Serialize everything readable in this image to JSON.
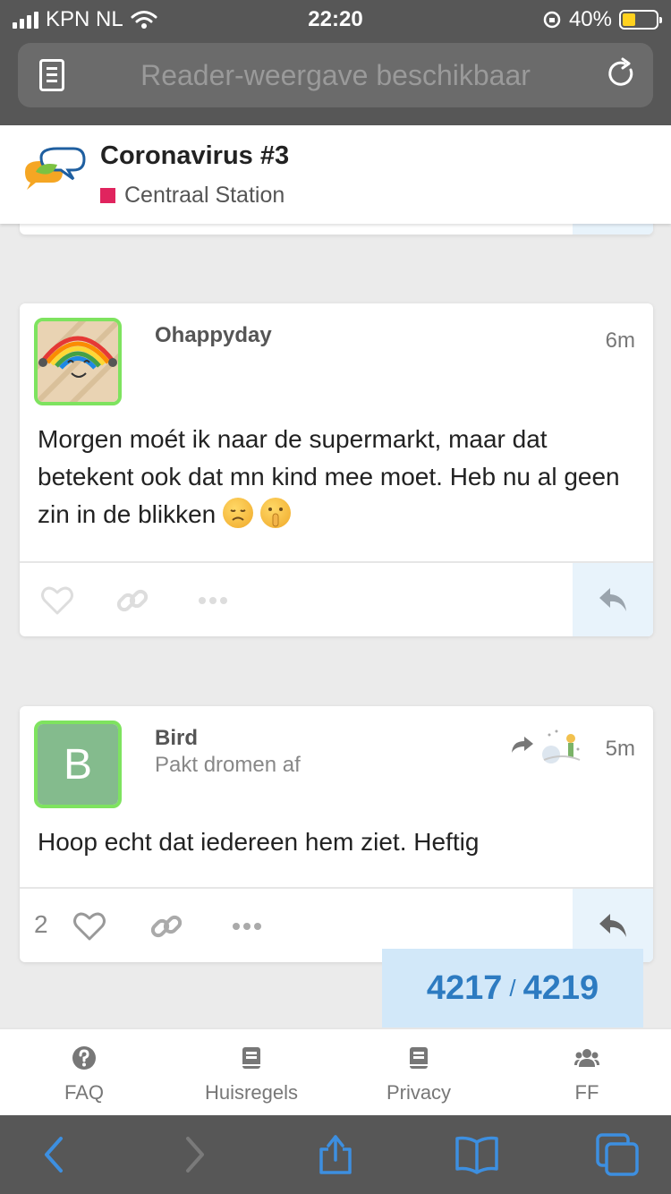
{
  "status_bar": {
    "carrier": "KPN NL",
    "time": "22:20",
    "battery": "40%",
    "battery_level": 0.4
  },
  "browser": {
    "url_placeholder": "Reader-weergave beschikbaar"
  },
  "topic": {
    "title": "Coronavirus #3",
    "category": "Centraal Station",
    "category_color": "#e0245e"
  },
  "posts": [
    {
      "username": "Ohappyday",
      "time": "6m",
      "body": "Morgen moét ik naar de supermarkt, maar dat betekent ook dat mn kind mee moet. Heb nu al geen zin in de blikken",
      "emojis": [
        "disappointed-face",
        "shushing-face"
      ],
      "avatar": "rainbow-face"
    },
    {
      "username": "Bird",
      "user_title": "Pakt dromen af",
      "avatar_letter": "B",
      "avatar_color": "#84bb8d",
      "time": "5m",
      "body": "Hoop echt dat iedereen hem ziet. Heftig",
      "like_count": "2"
    }
  ],
  "progress": {
    "current": "4217",
    "separator": "/",
    "total": "4219"
  },
  "footer_nav": [
    {
      "label": "FAQ",
      "icon": "question-circle-icon"
    },
    {
      "label": "Huisregels",
      "icon": "book-icon"
    },
    {
      "label": "Privacy",
      "icon": "book-icon"
    },
    {
      "label": "FF",
      "icon": "users-icon"
    }
  ],
  "colors": {
    "accent": "#2d7bc1",
    "avatar_border": "#7ee35f",
    "progress_bg": "#d2e8f9"
  }
}
